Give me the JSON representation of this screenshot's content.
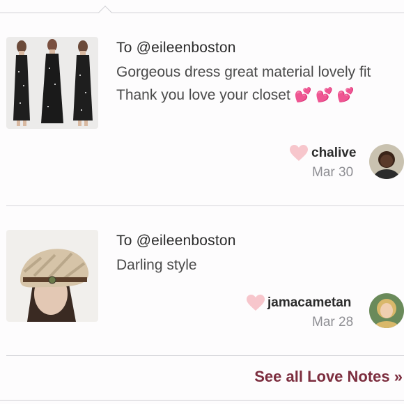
{
  "notes": [
    {
      "to": "To @eileenboston",
      "message": "Gorgeous dress great material lovely fit Thank you love your closet",
      "emojis": "💕 💕 💕",
      "author": "chalive",
      "date": "Mar 30",
      "thumbnail_icon": "maxi-dress-photo",
      "avatar_icon": "user-avatar"
    },
    {
      "to": "To @eileenboston",
      "message": "Darling style",
      "author": "jamacametan",
      "date": "Mar 28",
      "thumbnail_icon": "knit-hat-photo",
      "avatar_icon": "user-avatar"
    }
  ],
  "footer": {
    "see_all_label": "See all Love Notes »"
  },
  "colors": {
    "heart": "#f7c6cc",
    "link": "#7c2d3e",
    "muted_text": "#8e8e93"
  }
}
